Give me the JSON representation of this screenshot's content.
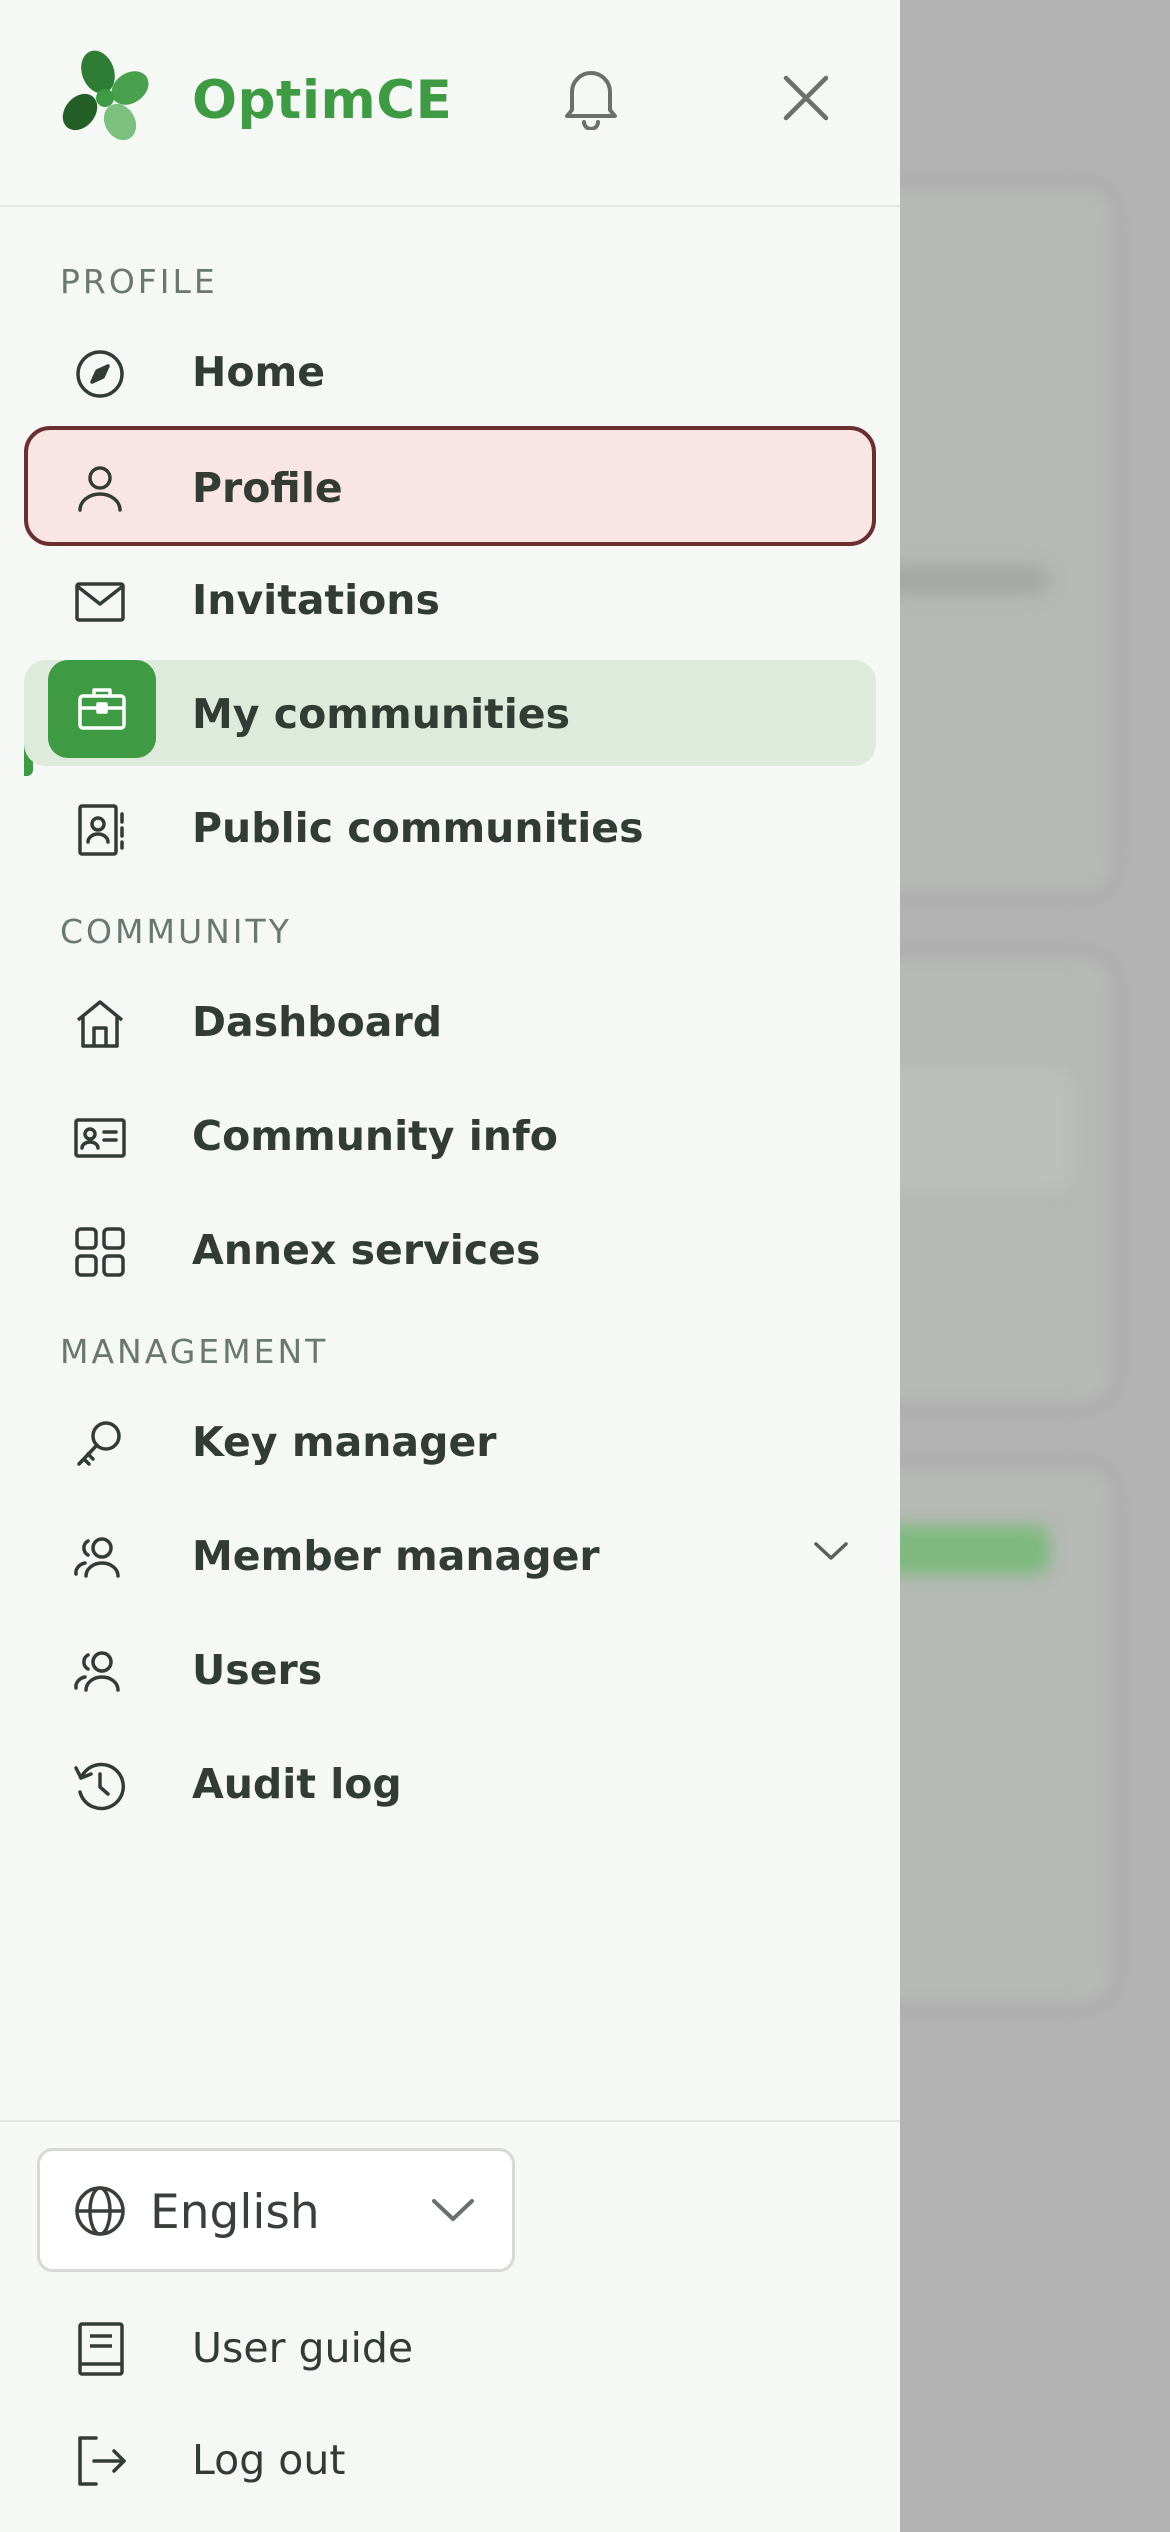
{
  "app": {
    "brand": "OptimCE"
  },
  "colors": {
    "accent": "#3e9a43",
    "focus_outline": "#6a2f2f",
    "focus_fill": "#f9e6e4",
    "active_fill": "#deebdc"
  },
  "header": {
    "icons": {
      "logo": "clover-logo-icon",
      "notifications": "bell-icon",
      "close": "close-icon"
    }
  },
  "sections": {
    "profile": "PROFILE",
    "community": "COMMUNITY",
    "management": "MANAGEMENT"
  },
  "nav": {
    "home": {
      "label": "Home",
      "icon": "compass-icon"
    },
    "profile": {
      "label": "Profile",
      "icon": "user-icon",
      "state": "focused"
    },
    "invitations": {
      "label": "Invitations",
      "icon": "envelope-icon"
    },
    "my_communities": {
      "label": "My communities",
      "icon": "briefcase-icon",
      "state": "active"
    },
    "public_communities": {
      "label": "Public communities",
      "icon": "contact-book-icon"
    },
    "dashboard": {
      "label": "Dashboard",
      "icon": "house-icon"
    },
    "community_info": {
      "label": "Community info",
      "icon": "id-card-icon"
    },
    "annex_services": {
      "label": "Annex services",
      "icon": "grid-icon"
    },
    "key_manager": {
      "label": "Key manager",
      "icon": "key-icon"
    },
    "member_manager": {
      "label": "Member manager",
      "icon": "users-icon",
      "expand_icon": "chevron-down-icon"
    },
    "users": {
      "label": "Users",
      "icon": "users-icon"
    },
    "audit_log": {
      "label": "Audit log",
      "icon": "history-icon"
    }
  },
  "footer": {
    "language": {
      "value": "English",
      "icon": "globe-icon"
    },
    "user_guide": {
      "label": "User guide",
      "icon": "book-icon"
    },
    "logout": {
      "label": "Log out",
      "icon": "logout-icon"
    }
  }
}
